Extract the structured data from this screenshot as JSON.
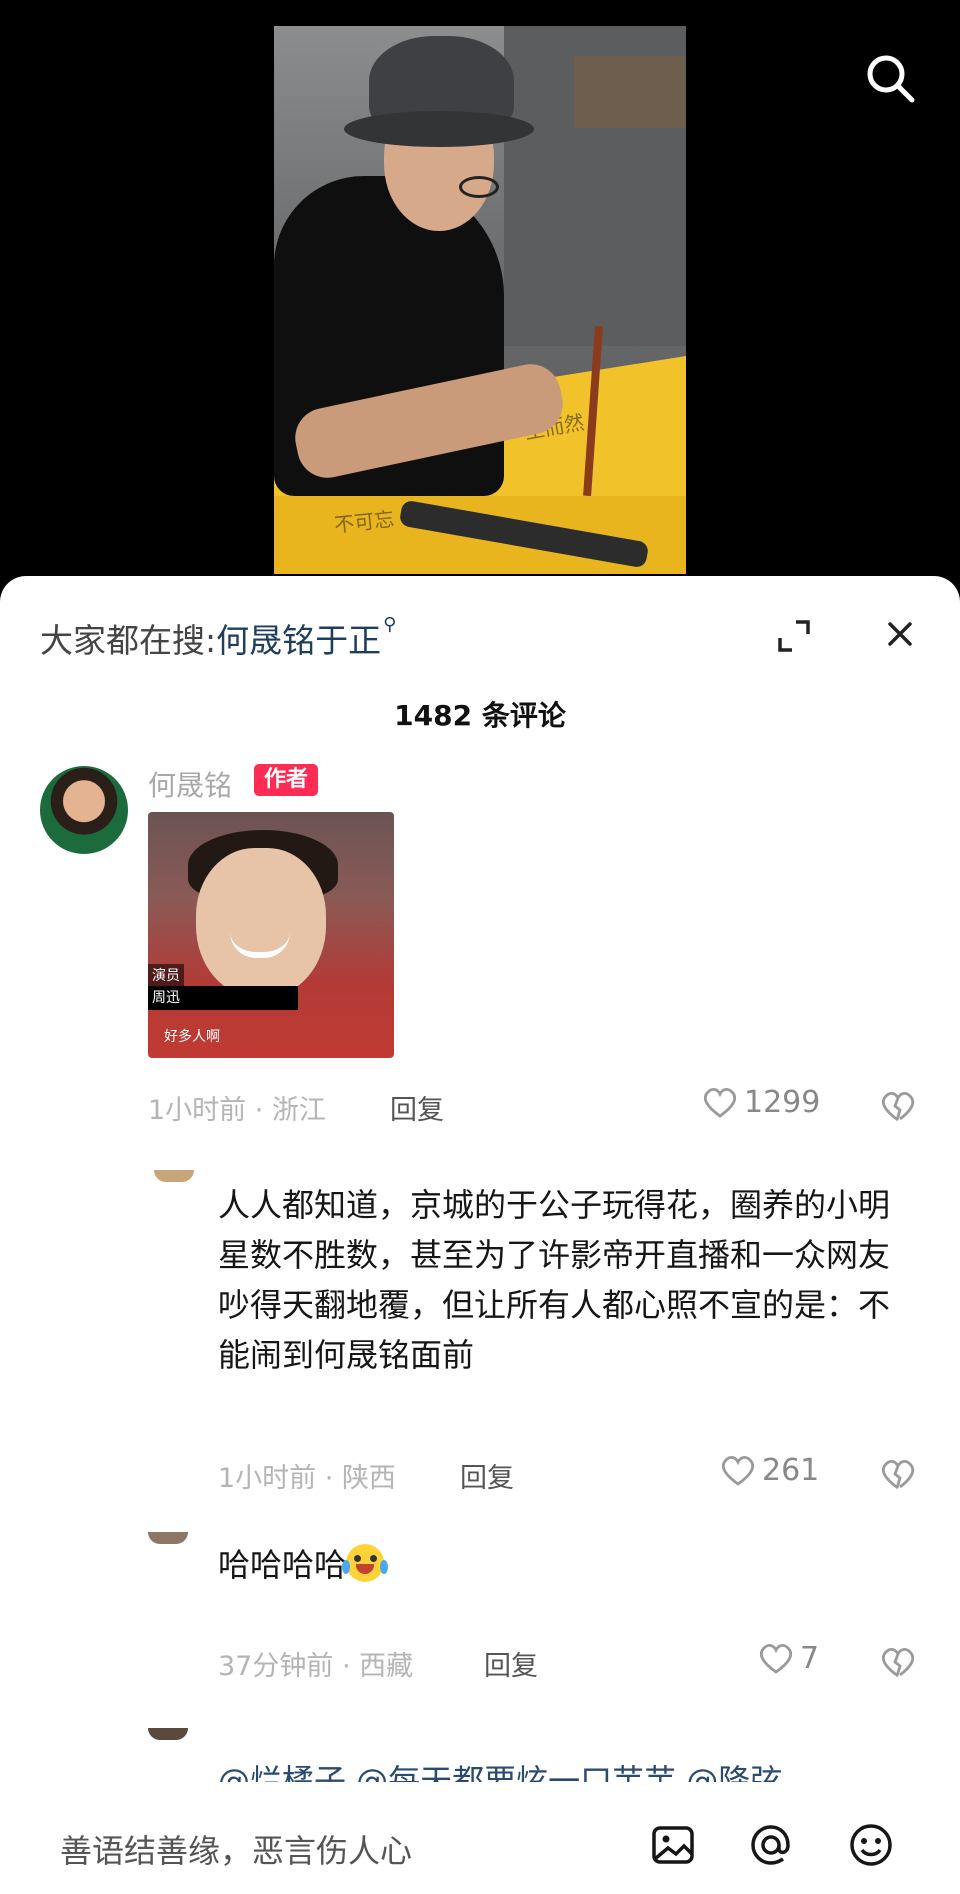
{
  "video": {
    "calligraphy_fragments": [
      "至而然",
      "不可忘"
    ]
  },
  "sheet": {
    "hot_search_prefix": "大家都在搜:",
    "hot_search_term": "何晟铭于正",
    "comment_count": "1482 条评论"
  },
  "comments": [
    {
      "username": "何晟铭",
      "badge": "作者",
      "image_captions": {
        "label": "演员",
        "name": "周迅",
        "subtitle": "好多人啊"
      },
      "time": "1小时前",
      "location": "浙江",
      "reply": "回复",
      "likes": "1299"
    },
    {
      "text": "人人都知道，京城的于公子玩得花，圈养的小明星数不胜数，甚至为了许影帝开直播和一众网友吵得天翻地覆，但让所有人都心照不宣的是：不能闹到何晟铭面前",
      "time": "1小时前",
      "location": "陕西",
      "reply": "回复",
      "likes": "261"
    },
    {
      "text": "哈哈哈哈",
      "time": "37分钟前",
      "location": "西藏",
      "reply": "回复",
      "likes": "7"
    },
    {
      "text": "@烂橘子 @每天都要炫一口芋芋 @降弦"
    }
  ],
  "input": {
    "placeholder": "善语结善缘，恶言伤人心"
  },
  "icons": [
    "search-icon",
    "expand-icon",
    "close-icon",
    "heart-icon",
    "broken-heart-icon",
    "image-icon",
    "at-icon",
    "emoji-icon"
  ],
  "colors": {
    "author_badge": "#fe2c55",
    "hot_search_term": "#1f3d5c",
    "meta_text": "#b5b5b5"
  }
}
